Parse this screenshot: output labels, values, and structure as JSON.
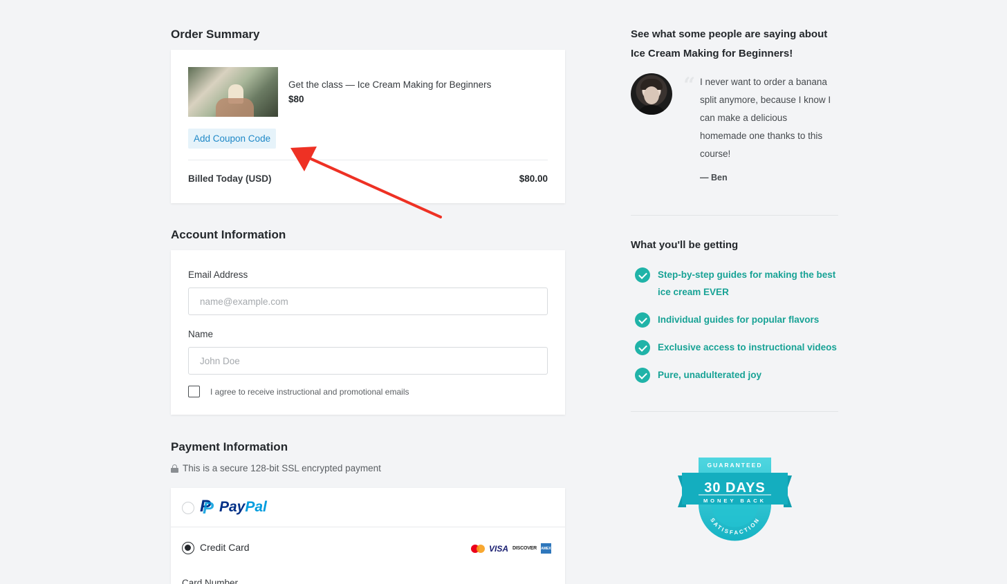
{
  "order": {
    "title": "Order Summary",
    "product_name": "Get the class — Ice Cream Making for Beginners",
    "product_price": "$80",
    "coupon_label": "Add Coupon Code",
    "billed_label": "Billed Today (USD)",
    "billed_value": "$80.00"
  },
  "account": {
    "title": "Account Information",
    "email_label": "Email Address",
    "email_placeholder": "name@example.com",
    "name_label": "Name",
    "name_placeholder": "John Doe",
    "consent_label": "I agree to receive instructional and promotional emails"
  },
  "payment": {
    "title": "Payment Information",
    "secure_text": "This is a secure 128-bit SSL encrypted payment",
    "paypal_pay": "Pay",
    "paypal_pal": "Pal",
    "credit_card_label": "Credit Card",
    "card_number_label": "Card Number",
    "visa": "VISA",
    "discover": "DISCOVER",
    "amex": "AMEX",
    "selected_method": "credit-card"
  },
  "testimonial": {
    "heading": "See what some people are saying about Ice Cream Making for Beginners!",
    "quote": "I never want to order a banana split anymore, because I know I can make a delicious homemade one thanks to this course!",
    "author": "— Ben"
  },
  "benefits": {
    "title": "What you'll be getting",
    "items": [
      "Step-by-step guides for making the best ice cream EVER",
      "Individual guides for popular flavors",
      "Exclusive access to instructional videos",
      "Pure, unadulterated joy"
    ]
  },
  "badge": {
    "top": "GUARANTEED",
    "main": "30 DAYS",
    "sub": "MONEY BACK",
    "bottom": "SATISFACTION"
  },
  "colors": {
    "accent_teal": "#20b3a8",
    "link_blue": "#1e88c7",
    "arrow_red": "#ee3124"
  }
}
